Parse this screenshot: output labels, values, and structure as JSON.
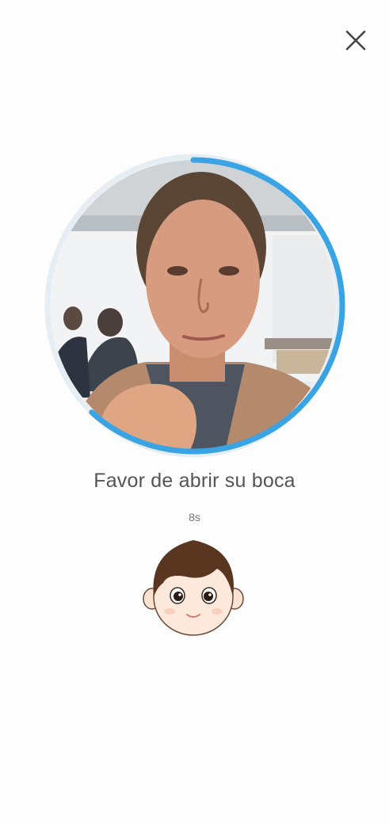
{
  "header": {
    "close_icon": "close-icon"
  },
  "capture": {
    "progress": 0.62,
    "ring_color": "#3aa3e3",
    "track_color": "#e6eef4"
  },
  "instruction": {
    "text": "Favor de abrir su boca"
  },
  "countdown": {
    "text": "8s"
  },
  "illustration": {
    "icon": "face-illustration"
  }
}
